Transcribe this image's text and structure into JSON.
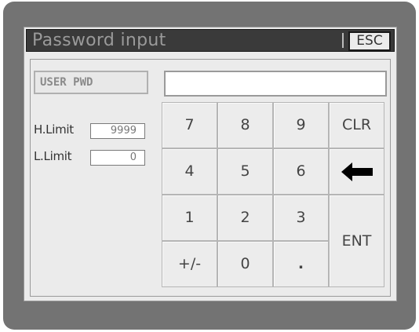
{
  "title": "Password input",
  "esc_label": "ESC",
  "user_pwd_label": "USER PWD",
  "password_value": "",
  "h_limit": {
    "label": "H.Limit",
    "value": "9999"
  },
  "l_limit": {
    "label": "L.Limit",
    "value": "0"
  },
  "keys": {
    "k7": "7",
    "k8": "8",
    "k9": "9",
    "clr": "CLR",
    "k4": "4",
    "k5": "5",
    "k6": "6",
    "backspace_icon": "left-arrow-icon",
    "k1": "1",
    "k2": "2",
    "k3": "3",
    "ent": "ENT",
    "plusminus": "+/-",
    "k0": "0",
    "dot": "."
  },
  "colors": {
    "bezel": "#737373",
    "screen": "#ebebeb",
    "titlebar": "#3a3a3a"
  }
}
